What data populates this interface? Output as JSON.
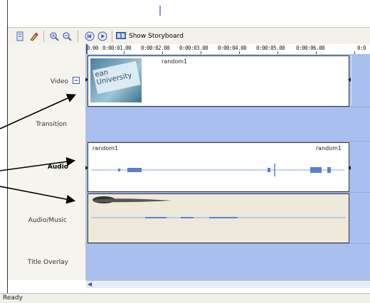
{
  "toolbar": {
    "items": [
      {
        "name": "properties-icon"
      },
      {
        "name": "audio-levels-icon"
      },
      {
        "name": "zoom-in-icon"
      },
      {
        "name": "zoom-out-icon"
      },
      {
        "name": "rewind-icon"
      },
      {
        "name": "play-icon"
      }
    ],
    "storyboard_label": "Show Storyboard",
    "storyboard_icon": "storyboard-icon"
  },
  "ruler": {
    "ticks": [
      "0.00",
      "0:00:01.00",
      "0:00:02.00",
      "0:00:03.00",
      "0:00:04.00",
      "0:00:05.00",
      "0:00:06.00",
      "0:0"
    ]
  },
  "tracks": {
    "video": "Video",
    "transition": "Transition",
    "audio": "Audio",
    "audio_music": "Audio/Music",
    "title_overlay": "Title Overlay"
  },
  "clips": {
    "video_title": "random1",
    "thumbnail_text": "ean\nUniversity",
    "audio_title_left": "random1",
    "audio_title_right": "random1"
  },
  "status": {
    "text": "Ready"
  },
  "colors": {
    "track_bg": "#a9c0ee",
    "clip_white": "#ffffff",
    "music_bg": "#efe9dc",
    "waveform": "#5b7ed1"
  }
}
